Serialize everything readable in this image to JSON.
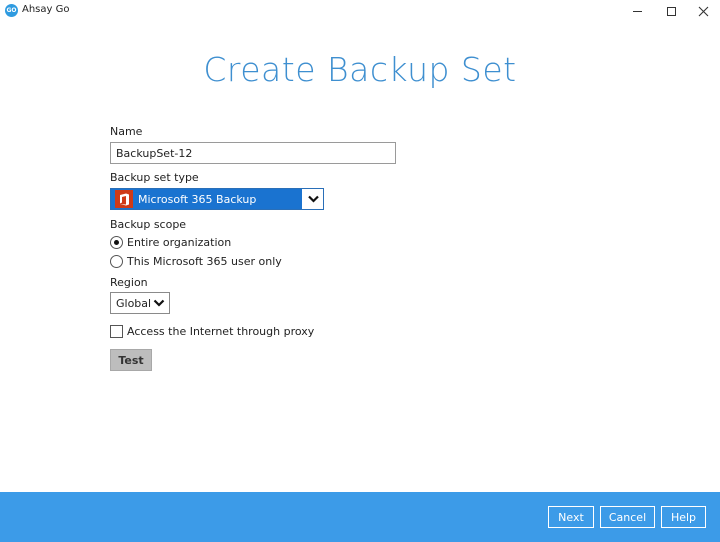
{
  "window": {
    "app_title": "Ahsay Go",
    "logo_text": "GO"
  },
  "page": {
    "title": "Create Backup Set"
  },
  "form": {
    "name_label": "Name",
    "name_value": "BackupSet-12",
    "type_label": "Backup set type",
    "type_value": "Microsoft 365 Backup",
    "scope_label": "Backup scope",
    "scope_options": [
      {
        "label": "Entire organization",
        "selected": true
      },
      {
        "label": "This Microsoft 365 user only",
        "selected": false
      }
    ],
    "region_label": "Region",
    "region_value": "Global",
    "proxy_label": "Access the Internet through proxy",
    "proxy_checked": false,
    "test_label": "Test"
  },
  "footer": {
    "next_label": "Next",
    "cancel_label": "Cancel",
    "help_label": "Help"
  },
  "colors": {
    "accent": "#3e8fd0",
    "footer_bg": "#3c9be8",
    "select_highlight": "#1a73d0",
    "office_icon": "#cf3a17"
  },
  "icons": {
    "app": "ahsay-go-logo-icon",
    "minimize": "minimize-icon",
    "maximize": "maximize-icon",
    "close": "close-icon",
    "office": "office-365-icon",
    "dropdown": "chevron-down-icon"
  }
}
